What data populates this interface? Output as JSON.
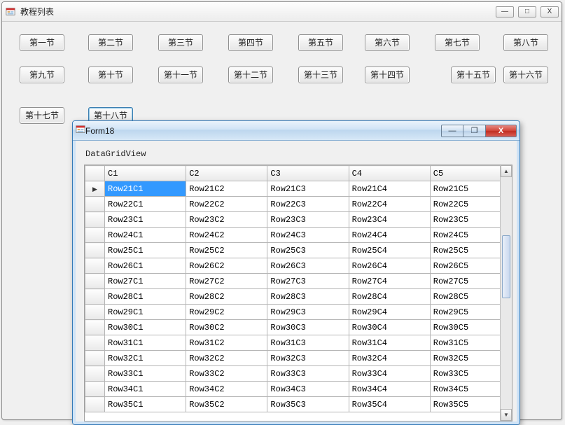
{
  "main": {
    "title": "教程列表",
    "buttons": [
      "第一节",
      "第二节",
      "第三节",
      "第四节",
      "第五节",
      "第六节",
      "第七节",
      "第八节",
      "第九节",
      "第十节",
      "第十一节",
      "第十二节",
      "第十三节",
      "第十四节",
      "第十五节",
      "第十六节",
      "第十七节",
      "第十八节"
    ],
    "focused_button_index": 17,
    "win_min": "—",
    "win_max": "□",
    "win_close": "X"
  },
  "child": {
    "title": "Form18",
    "label": "DataGridView",
    "win_min": "—",
    "win_max": "❐",
    "win_close": "X",
    "grid": {
      "columns": [
        "C1",
        "C2",
        "C3",
        "C4",
        "C5"
      ],
      "selected": {
        "row": 0,
        "col": 0
      },
      "rows": [
        [
          "Row21C1",
          "Row21C2",
          "Row21C3",
          "Row21C4",
          "Row21C5"
        ],
        [
          "Row22C1",
          "Row22C2",
          "Row22C3",
          "Row22C4",
          "Row22C5"
        ],
        [
          "Row23C1",
          "Row23C2",
          "Row23C3",
          "Row23C4",
          "Row23C5"
        ],
        [
          "Row24C1",
          "Row24C2",
          "Row24C3",
          "Row24C4",
          "Row24C5"
        ],
        [
          "Row25C1",
          "Row25C2",
          "Row25C3",
          "Row25C4",
          "Row25C5"
        ],
        [
          "Row26C1",
          "Row26C2",
          "Row26C3",
          "Row26C4",
          "Row26C5"
        ],
        [
          "Row27C1",
          "Row27C2",
          "Row27C3",
          "Row27C4",
          "Row27C5"
        ],
        [
          "Row28C1",
          "Row28C2",
          "Row28C3",
          "Row28C4",
          "Row28C5"
        ],
        [
          "Row29C1",
          "Row29C2",
          "Row29C3",
          "Row29C4",
          "Row29C5"
        ],
        [
          "Row30C1",
          "Row30C2",
          "Row30C3",
          "Row30C4",
          "Row30C5"
        ],
        [
          "Row31C1",
          "Row31C2",
          "Row31C3",
          "Row31C4",
          "Row31C5"
        ],
        [
          "Row32C1",
          "Row32C2",
          "Row32C3",
          "Row32C4",
          "Row32C5"
        ],
        [
          "Row33C1",
          "Row33C2",
          "Row33C3",
          "Row33C4",
          "Row33C5"
        ],
        [
          "Row34C1",
          "Row34C2",
          "Row34C3",
          "Row34C4",
          "Row34C5"
        ],
        [
          "Row35C1",
          "Row35C2",
          "Row35C3",
          "Row35C4",
          "Row35C5"
        ]
      ]
    }
  }
}
